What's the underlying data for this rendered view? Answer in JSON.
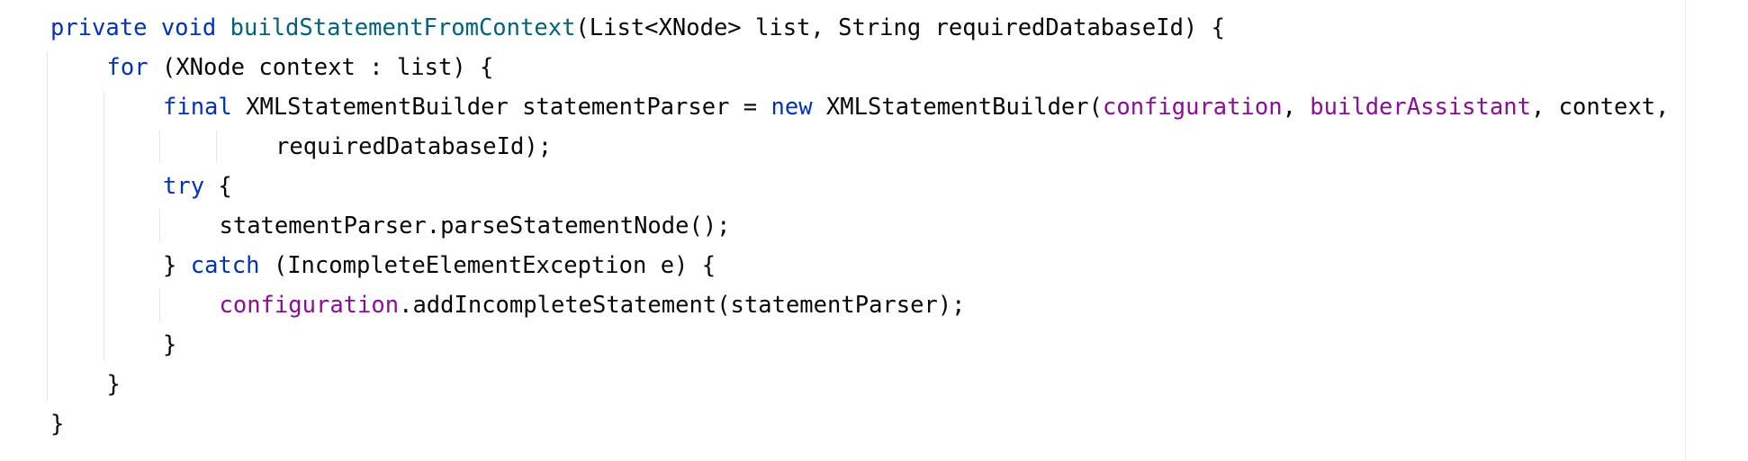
{
  "editor": {
    "lines": [
      {
        "indent": 0,
        "tokens": [
          {
            "type": "kw",
            "text": "private"
          },
          {
            "type": "plain",
            "text": " "
          },
          {
            "type": "kw",
            "text": "void"
          },
          {
            "type": "plain",
            "text": " "
          },
          {
            "type": "fn",
            "text": "buildStatementFromContext"
          },
          {
            "type": "plain",
            "text": "(List<XNode> list, String requiredDatabaseId) {"
          }
        ]
      },
      {
        "indent": 1,
        "tokens": [
          {
            "type": "kw",
            "text": "for"
          },
          {
            "type": "plain",
            "text": " (XNode context : list) {"
          }
        ]
      },
      {
        "indent": 2,
        "tokens": [
          {
            "type": "kw",
            "text": "final"
          },
          {
            "type": "plain",
            "text": " XMLStatementBuilder statementParser = "
          },
          {
            "type": "kw",
            "text": "new"
          },
          {
            "type": "plain",
            "text": " XMLStatementBuilder("
          },
          {
            "type": "field",
            "text": "configuration"
          },
          {
            "type": "plain",
            "text": ", "
          },
          {
            "type": "field",
            "text": "builderAssistant"
          },
          {
            "type": "plain",
            "text": ", context,"
          }
        ]
      },
      {
        "indent": 4,
        "tokens": [
          {
            "type": "plain",
            "text": "requiredDatabaseId);"
          }
        ]
      },
      {
        "indent": 2,
        "tokens": [
          {
            "type": "kw",
            "text": "try"
          },
          {
            "type": "plain",
            "text": " {"
          }
        ]
      },
      {
        "indent": 3,
        "tokens": [
          {
            "type": "plain",
            "text": "statementParser.parseStatementNode();"
          }
        ]
      },
      {
        "indent": 2,
        "tokens": [
          {
            "type": "plain",
            "text": "} "
          },
          {
            "type": "kw",
            "text": "catch"
          },
          {
            "type": "plain",
            "text": " (IncompleteElementException e) {"
          }
        ]
      },
      {
        "indent": 3,
        "tokens": [
          {
            "type": "field",
            "text": "configuration"
          },
          {
            "type": "plain",
            "text": ".addIncompleteStatement(statementParser);"
          }
        ]
      },
      {
        "indent": 2,
        "tokens": [
          {
            "type": "plain",
            "text": "}"
          }
        ]
      },
      {
        "indent": 1,
        "tokens": [
          {
            "type": "plain",
            "text": "}"
          }
        ]
      },
      {
        "indent": 0,
        "tokens": [
          {
            "type": "plain",
            "text": "}"
          }
        ]
      }
    ]
  },
  "colors": {
    "keyword": "#0033b3",
    "method_declaration": "#00627a",
    "field": "#871094",
    "text": "#080808",
    "indent_guide": "#e6e6e6",
    "background": "#ffffff"
  }
}
